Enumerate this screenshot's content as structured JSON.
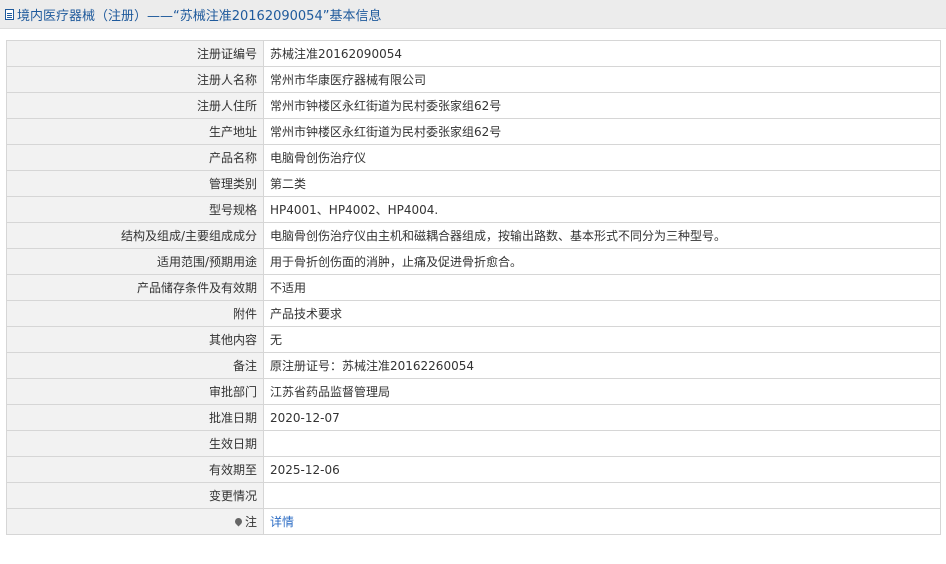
{
  "header": {
    "title": "境内医疗器械（注册）——“苏械注准20162090054”基本信息"
  },
  "rows": [
    {
      "label": "注册证编号",
      "value": "苏械注准20162090054"
    },
    {
      "label": "注册人名称",
      "value": "常州市华康医疗器械有限公司"
    },
    {
      "label": "注册人住所",
      "value": "常州市钟楼区永红街道为民村委张家组62号"
    },
    {
      "label": "生产地址",
      "value": "常州市钟楼区永红街道为民村委张家组62号"
    },
    {
      "label": "产品名称",
      "value": "电脑骨创伤治疗仪"
    },
    {
      "label": "管理类别",
      "value": "第二类"
    },
    {
      "label": "型号规格",
      "value": "HP4001、HP4002、HP4004."
    },
    {
      "label": "结构及组成/主要组成成分",
      "value": "电脑骨创伤治疗仪由主机和磁耦合器组成，按输出路数、基本形式不同分为三种型号。"
    },
    {
      "label": "适用范围/预期用途",
      "value": "用于骨折创伤面的消肿，止痛及促进骨折愈合。"
    },
    {
      "label": "产品储存条件及有效期",
      "value": "不适用"
    },
    {
      "label": "附件",
      "value": "产品技术要求"
    },
    {
      "label": "其他内容",
      "value": "无"
    },
    {
      "label": "备注",
      "value": "原注册证号：苏械注准20162260054"
    },
    {
      "label": "审批部门",
      "value": "江苏省药品监督管理局"
    },
    {
      "label": "批准日期",
      "value": "2020-12-07"
    },
    {
      "label": "生效日期",
      "value": ""
    },
    {
      "label": "有效期至",
      "value": "2025-12-06"
    },
    {
      "label": "变更情况",
      "value": ""
    }
  ],
  "note": {
    "label": "注",
    "link_text": "详情"
  }
}
